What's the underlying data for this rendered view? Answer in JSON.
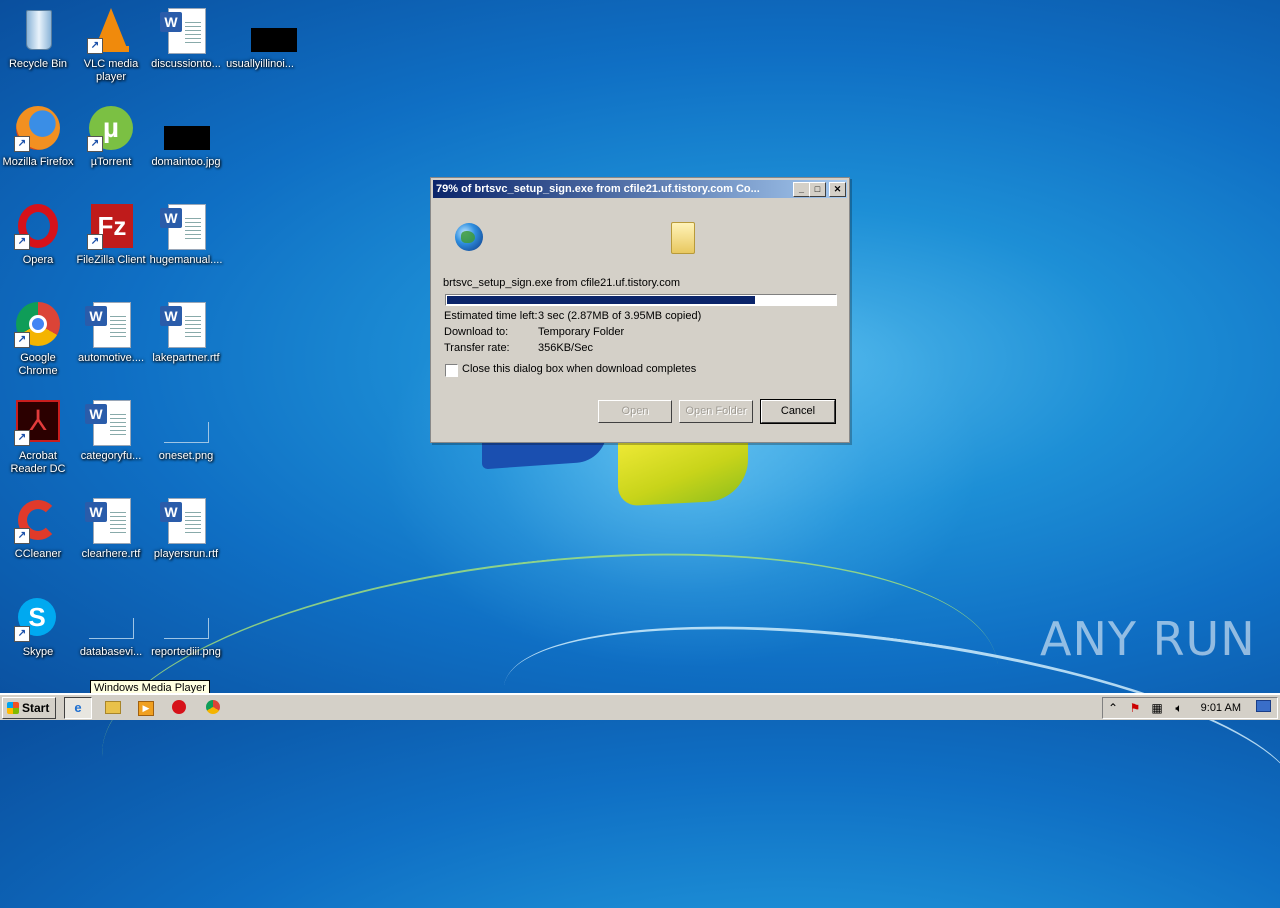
{
  "desktop": {
    "icons": [
      {
        "label": "Recycle Bin"
      },
      {
        "label": "VLC media player"
      },
      {
        "label": "discussionto..."
      },
      {
        "label": "usuallyillinoi..."
      },
      {
        "label": "Mozilla Firefox"
      },
      {
        "label": "µTorrent"
      },
      {
        "label": "domaintoo.jpg"
      },
      {
        "label": "Opera"
      },
      {
        "label": "FileZilla Client"
      },
      {
        "label": "hugemanual...."
      },
      {
        "label": "Google Chrome"
      },
      {
        "label": "automotive...."
      },
      {
        "label": "lakepartner.rtf"
      },
      {
        "label": "Acrobat Reader DC"
      },
      {
        "label": "categoryfu..."
      },
      {
        "label": "oneset.png"
      },
      {
        "label": "CCleaner"
      },
      {
        "label": "clearhere.rtf"
      },
      {
        "label": "playersrun.rtf"
      },
      {
        "label": "Skype"
      },
      {
        "label": "databasevi..."
      },
      {
        "label": "reportediii.png"
      }
    ]
  },
  "dialog": {
    "title": "79% of brtsvc_setup_sign.exe from cfile21.uf.tistory.com Co...",
    "file_line": "brtsvc_setup_sign.exe from cfile21.uf.tistory.com",
    "progress": 0.79,
    "fields": [
      {
        "label": "Estimated time left:",
        "value": "3 sec (2.87MB of 3.95MB copied)"
      },
      {
        "label": "Download to:",
        "value": "Temporary Folder"
      },
      {
        "label": "Transfer rate:",
        "value": "356KB/Sec"
      }
    ],
    "close_checkbox_label": "Close this dialog box when download completes",
    "buttons": {
      "open": "Open",
      "open_folder": "Open Folder",
      "cancel": "Cancel"
    }
  },
  "taskbar": {
    "start_label": "Start",
    "tooltip": "Windows Media Player",
    "clock": "9:01 AM"
  },
  "watermark": "ANY RUN"
}
